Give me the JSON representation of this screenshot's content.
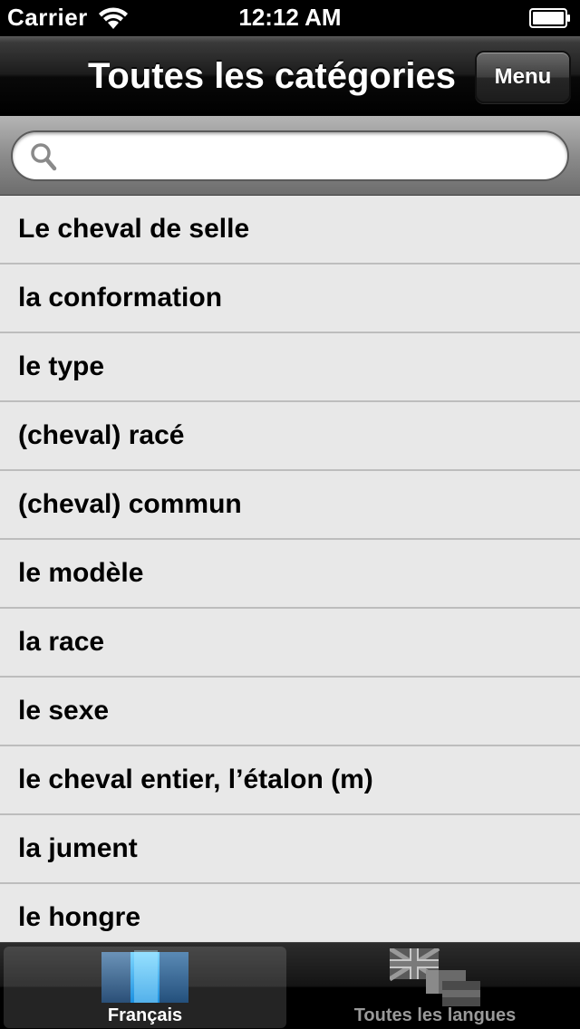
{
  "status_bar": {
    "carrier": "Carrier",
    "time": "12:12 AM"
  },
  "nav": {
    "title": "Toutes les catégories",
    "menu_label": "Menu"
  },
  "search": {
    "placeholder": "",
    "value": ""
  },
  "list": {
    "items": [
      "Le cheval de selle",
      "la conformation",
      "le type",
      "(cheval) racé",
      "(cheval) commun",
      "le modèle",
      "la race",
      "le sexe",
      "le cheval entier, l’étalon (m)",
      "la jument",
      "le hongre"
    ]
  },
  "tabs": [
    {
      "label": "Français",
      "icon": "french-flag-icon",
      "selected": true
    },
    {
      "label": "Toutes les langues",
      "icon": "union-jack-flags-icon",
      "selected": false
    }
  ],
  "colors": {
    "list_background": "#e8e8e8",
    "selected_tab_label": "#ffffff",
    "unselected_tab_label": "#9a9a9a"
  }
}
